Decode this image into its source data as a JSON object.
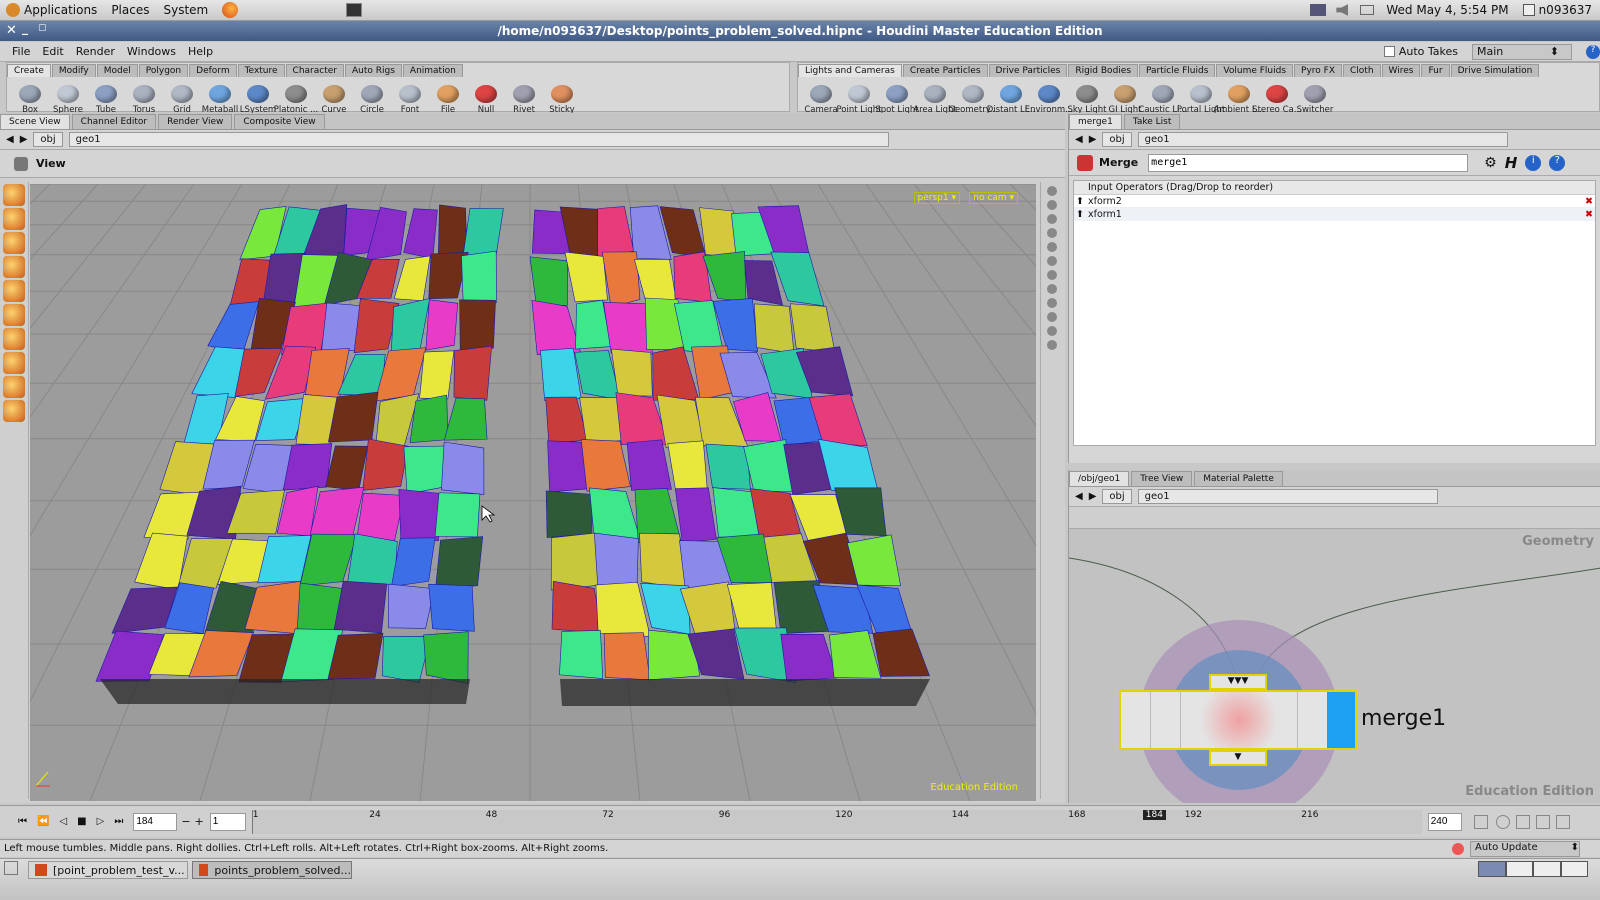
{
  "gnome": {
    "applications": "Applications",
    "places": "Places",
    "system": "System",
    "datetime": "Wed May  4,  5:54 PM",
    "user": "n093637"
  },
  "window": {
    "title": "/home/n093637/Desktop/points_problem_solved.hipnc - Houdini Master Education Edition"
  },
  "menu": [
    "File",
    "Edit",
    "Render",
    "Windows",
    "Help"
  ],
  "auto_takes": "Auto Takes",
  "desk": "Main",
  "shelf_left": {
    "tabs": [
      "Create",
      "Modify",
      "Model",
      "Polygon",
      "Deform",
      "Texture",
      "Character",
      "Auto Rigs",
      "Animation"
    ],
    "tools": [
      "Box",
      "Sphere",
      "Tube",
      "Torus",
      "Grid",
      "Metaball",
      "LSystem",
      "Platonic ...",
      "Curve",
      "Circle",
      "Font",
      "File",
      "Null",
      "Rivet",
      "Sticky"
    ]
  },
  "shelf_right": {
    "tabs": [
      "Lights and Cameras",
      "Create Particles",
      "Drive Particles",
      "Rigid Bodies",
      "Particle Fluids",
      "Volume Fluids",
      "Pyro FX",
      "Cloth",
      "Wires",
      "Fur",
      "Drive Simulation"
    ],
    "tools": [
      "Camera",
      "Point Light",
      "Spot Light",
      "Area Light",
      "Geometry...",
      "Distant Li...",
      "Environm...",
      "Sky Light",
      "GI Light",
      "Caustic Li...",
      "Portal Light",
      "Ambient L...",
      "Stereo Ca...",
      "Switcher"
    ]
  },
  "scene": {
    "tabs": [
      "Scene View",
      "Channel Editor",
      "Render View",
      "Composite View"
    ],
    "path": [
      "obj",
      "geo1"
    ],
    "view_label": "View",
    "cam1": "persp1",
    "cam2": "no cam",
    "watermark": "Education Edition"
  },
  "params": {
    "tabs": [
      "merge1",
      "Take List"
    ],
    "path": [
      "obj",
      "geo1"
    ],
    "op_type": "Merge",
    "node_name": "merge1",
    "input_header": "Input Operators (Drag/Drop to reorder)",
    "inputs": [
      "xform2",
      "xform1"
    ]
  },
  "network": {
    "tabs": [
      "/obj/geo1",
      "Tree View",
      "Material Palette"
    ],
    "path": [
      "obj",
      "geo1"
    ],
    "context": "Geometry",
    "node_label": "merge1",
    "watermark": "Education Edition"
  },
  "timeline": {
    "frame": "184",
    "step": "1",
    "ticks": [
      "1",
      "24",
      "48",
      "72",
      "96",
      "120",
      "144",
      "168",
      "192",
      "216"
    ],
    "current": "184",
    "end": "240",
    "auto_update": "Auto Update"
  },
  "status": "Left mouse tumbles. Middle pans. Right dollies. Ctrl+Left rolls. Alt+Left rotates. Ctrl+Right box-zooms. Alt+Right zooms.",
  "taskbar": [
    "[point_problem_test_v...",
    "points_problem_solved..."
  ],
  "colors": {
    "accent": "#4a6591",
    "node_blue": "#1ea0f0",
    "node_border": "#e2d200"
  }
}
